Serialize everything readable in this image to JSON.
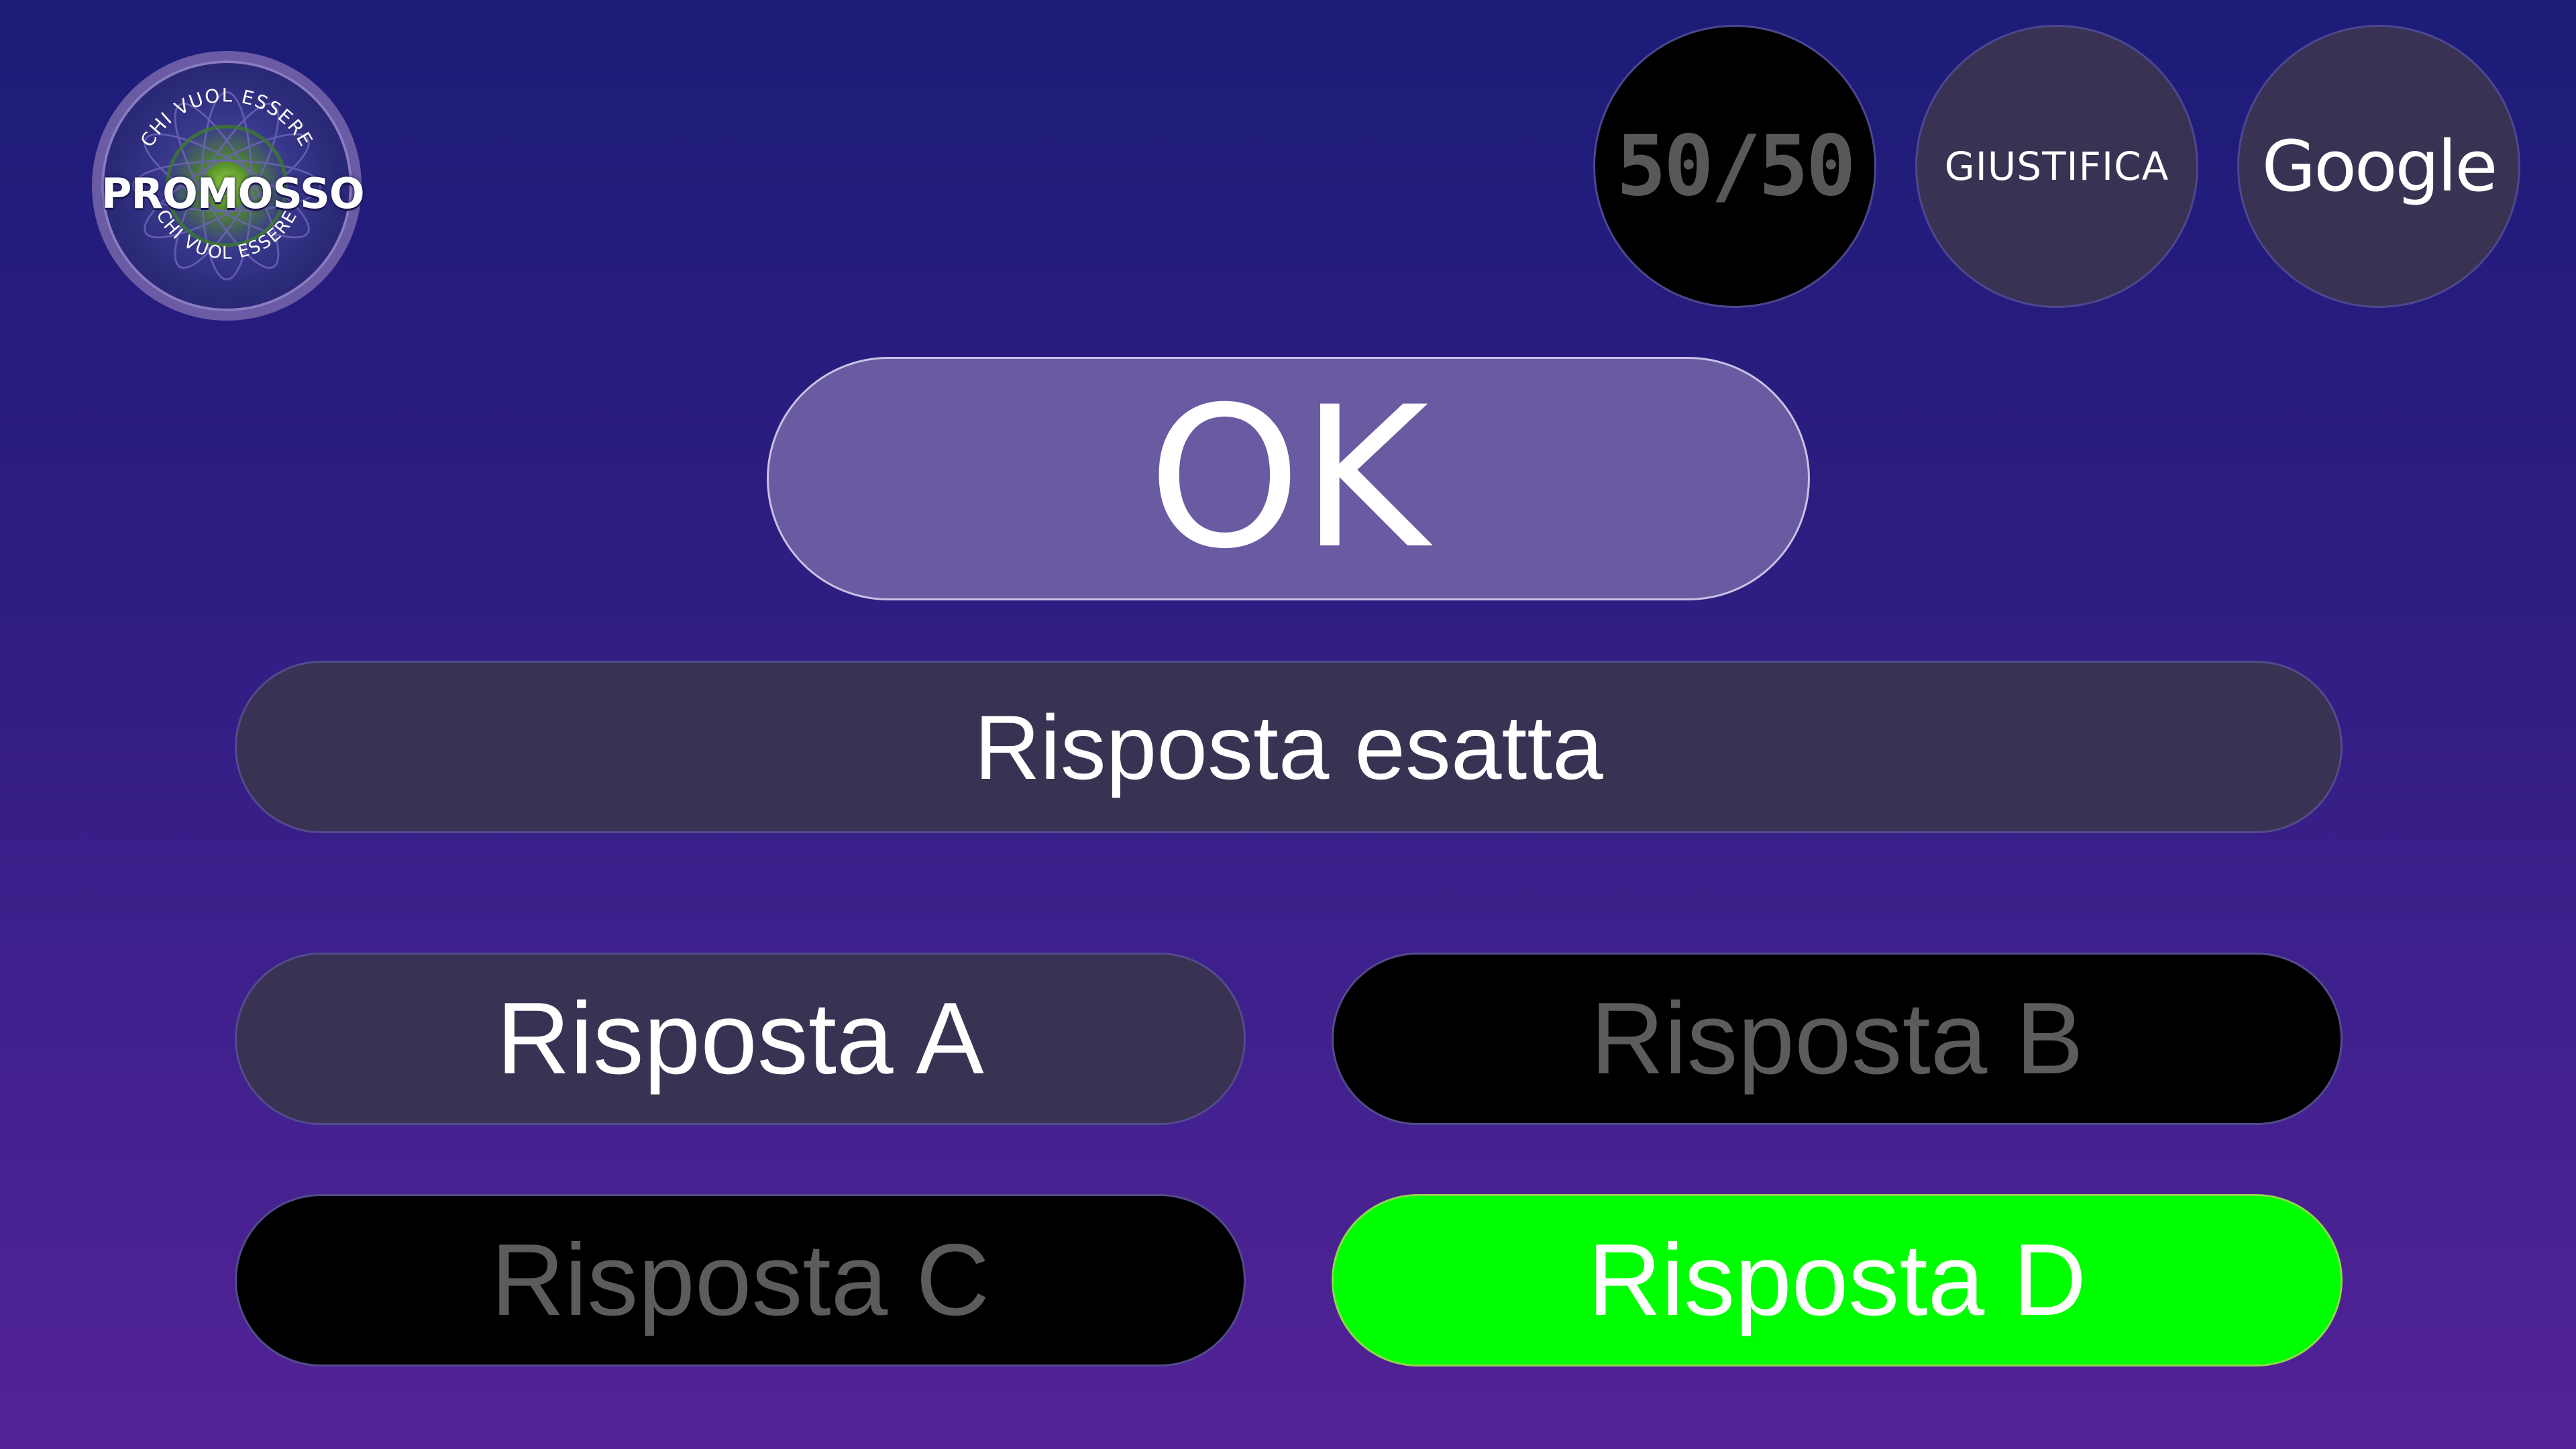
{
  "logo": {
    "top_text": "CHI VUOL ESSERE",
    "title": "PROMOSSO",
    "bottom_text": "CHI VUOL ESSERE"
  },
  "lifelines": {
    "fifty_fifty": "50/50",
    "justify": "GIUSTIFICA",
    "google": "Google"
  },
  "ok_button": {
    "label": "OK"
  },
  "question": {
    "text": "Risposta esatta"
  },
  "answers": [
    {
      "label": "Risposta A",
      "state": "neutral"
    },
    {
      "label": "Risposta B",
      "state": "eliminated"
    },
    {
      "label": "Risposta C",
      "state": "eliminated"
    },
    {
      "label": "Risposta D",
      "state": "correct"
    }
  ],
  "colors": {
    "background_top": "#1c1c78",
    "background_bottom": "#532396",
    "panel": "#3a3253",
    "ok_fill": "#6a5aa2",
    "eliminated_fill": "#000000",
    "eliminated_text": "#5c5c5c",
    "correct_fill": "#00ff00"
  }
}
